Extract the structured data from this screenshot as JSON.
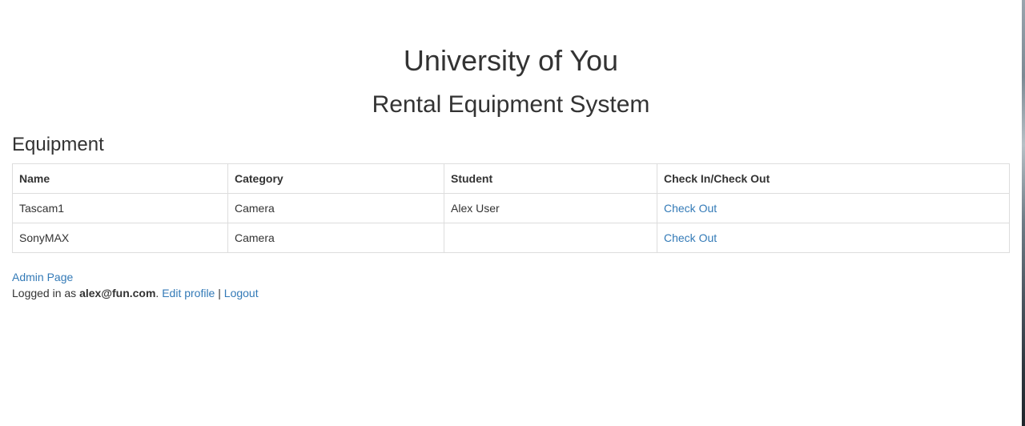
{
  "header": {
    "title": "University of You",
    "subtitle": "Rental Equipment System"
  },
  "equipment": {
    "section_title": "Equipment",
    "columns": [
      "Name",
      "Category",
      "Student",
      "Check In/Check Out"
    ],
    "rows": [
      {
        "name": "Tascam1",
        "category": "Camera",
        "student": "Alex User",
        "action": "Check Out"
      },
      {
        "name": "SonyMAX",
        "category": "Camera",
        "student": "",
        "action": "Check Out"
      }
    ]
  },
  "footer": {
    "admin_link": "Admin Page",
    "logged_in_prefix": "Logged in as ",
    "email": "alex@fun.com",
    "period": ".",
    "edit_profile": "Edit profile",
    "separator": "|",
    "logout": "Logout"
  },
  "colors": {
    "text": "#333333",
    "link": "#337ab7",
    "table_border": "#dddddd"
  }
}
